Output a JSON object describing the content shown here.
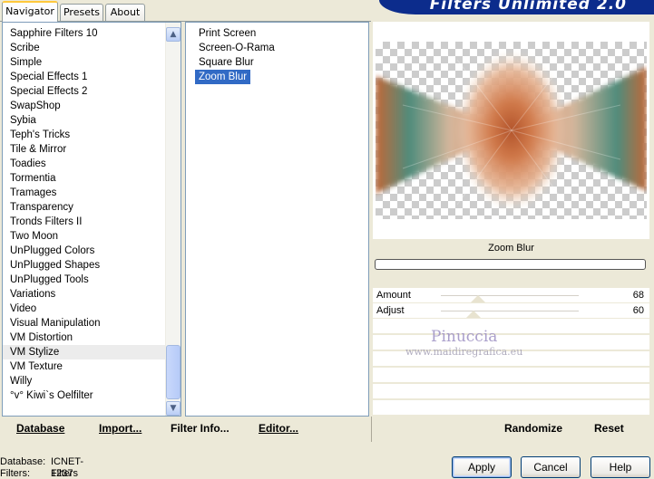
{
  "app": {
    "title": "Filters Unlimited 2.0"
  },
  "tabs": [
    {
      "label": "Navigator",
      "active": true
    },
    {
      "label": "Presets",
      "active": false
    },
    {
      "label": "About",
      "active": false
    }
  ],
  "categories": {
    "items": [
      "Sapphire Filters 10",
      "Scribe",
      "Simple",
      "Special Effects 1",
      "Special Effects 2",
      "SwapShop",
      "Sybia",
      "Teph's Tricks",
      "Tile & Mirror",
      "Toadies",
      "Tormentia",
      "Tramages",
      "Transparency",
      "Tronds Filters II",
      "Two Moon",
      "UnPlugged Colors",
      "UnPlugged Shapes",
      "UnPlugged Tools",
      "Variations",
      "Video",
      "Visual Manipulation",
      "VM Distortion",
      "VM Stylize",
      "VM Texture",
      "Willy",
      "°v° Kiwi`s Oelfilter"
    ],
    "selected": "VM Stylize"
  },
  "filters": {
    "items": [
      "Print Screen",
      "Screen-O-Rama",
      "Square Blur",
      "Zoom Blur"
    ],
    "selected": "Zoom Blur"
  },
  "preview": {
    "filter_name": "Zoom Blur",
    "colors": {
      "rust": "#c7683a",
      "teal": "#4f8c7c",
      "cream": "#efe0cd"
    }
  },
  "params": [
    {
      "label": "Amount",
      "value": "68",
      "level": 68
    },
    {
      "label": "Adjust",
      "value": "60",
      "level": 60
    }
  ],
  "watermark": {
    "name": "Pinuccia",
    "site": "www.maidiregrafica.eu"
  },
  "toolbar": {
    "database": "Database",
    "import": "Import...",
    "filter_info": "Filter Info...",
    "editor": "Editor...",
    "randomize": "Randomize",
    "reset": "Reset"
  },
  "status": {
    "database_label": "Database:",
    "database_value": "ICNET-Filters",
    "filters_label": "Filters:",
    "filters_value": "1237"
  },
  "dialog": {
    "apply": "Apply",
    "cancel": "Cancel",
    "help": "Help"
  }
}
